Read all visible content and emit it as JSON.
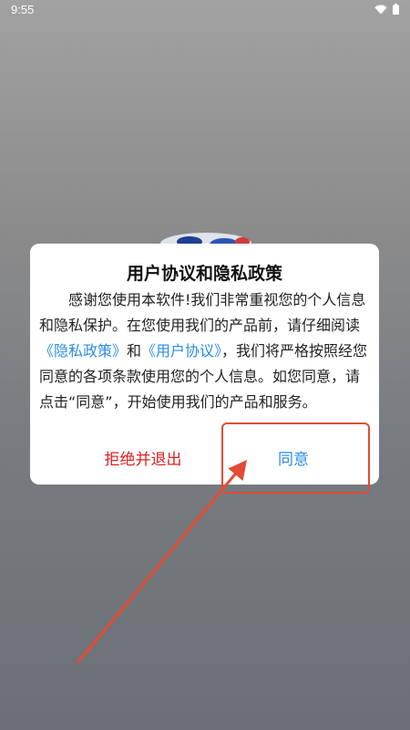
{
  "status_bar": {
    "time": "9:55",
    "icons": [
      "wifi-icon",
      "battery-icon"
    ]
  },
  "dialog": {
    "title": "用户协议和隐私政策",
    "body_intro": "感谢您使用本软件!我们非常重视您的个人信息和隐私保护。在您使用我们的产品前，请仔细阅读",
    "privacy_link": "《隐私政策》",
    "conjunction": "和",
    "user_agreement_link": "《用户协议》",
    "body_outro": "，我们将严格按照经您同意的各项条款使用您的个人信息。如您同意，请点击“同意”，开始使用我们的产品和服务。",
    "reject_label": "拒绝并退出",
    "agree_label": "同意"
  },
  "colors": {
    "link": "#2a8ce6",
    "reject": "#e02020",
    "annotation": "#e34b35"
  }
}
